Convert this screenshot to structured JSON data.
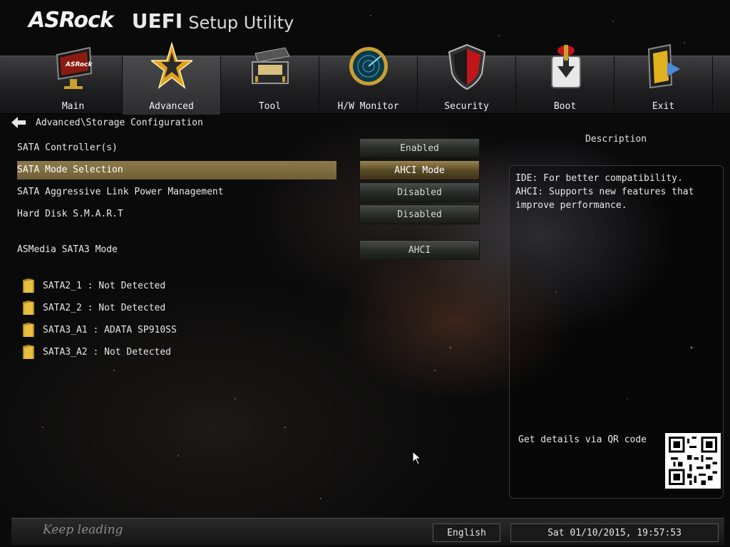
{
  "header": {
    "brand": "ASRock",
    "title_bold": "UEFI",
    "title_rest": "Setup Utility"
  },
  "nav": {
    "tabs": [
      {
        "label": "Main",
        "icon": "monitor-icon"
      },
      {
        "label": "Advanced",
        "icon": "star-icon",
        "active": true
      },
      {
        "label": "Tool",
        "icon": "toolbox-icon"
      },
      {
        "label": "H/W Monitor",
        "icon": "radar-icon"
      },
      {
        "label": "Security",
        "icon": "shield-icon"
      },
      {
        "label": "Boot",
        "icon": "boot-arrow-icon"
      },
      {
        "label": "Exit",
        "icon": "exit-door-icon"
      }
    ]
  },
  "breadcrumb": "Advanced\\Storage Configuration",
  "settings": [
    {
      "label": "SATA Controller(s)",
      "value": "Enabled"
    },
    {
      "label": "SATA Mode Selection",
      "value": "AHCI Mode",
      "selected": true
    },
    {
      "label": "SATA Aggressive Link Power Management",
      "value": "Disabled"
    },
    {
      "label": "Hard Disk S.M.A.R.T",
      "value": "Disabled"
    },
    {
      "label": "ASMedia SATA3 Mode",
      "value": "AHCI"
    }
  ],
  "drives": [
    "SATA2_1 : Not Detected",
    "SATA2_2 : Not Detected",
    "SATA3_A1 : ADATA SP910SS",
    "SATA3_A2 : Not Detected"
  ],
  "description": {
    "title": "Description",
    "text": "IDE: For better compatibility.\nAHCI: Supports new features that improve performance.",
    "qr_label": "Get details via QR code"
  },
  "footer": {
    "slogan": "Keep leading",
    "language": "English",
    "datetime": "Sat 01/10/2015, 19:57:53"
  },
  "colors": {
    "accent_gold": "#8d7a4a",
    "panel_border": "#3a3a3a"
  }
}
